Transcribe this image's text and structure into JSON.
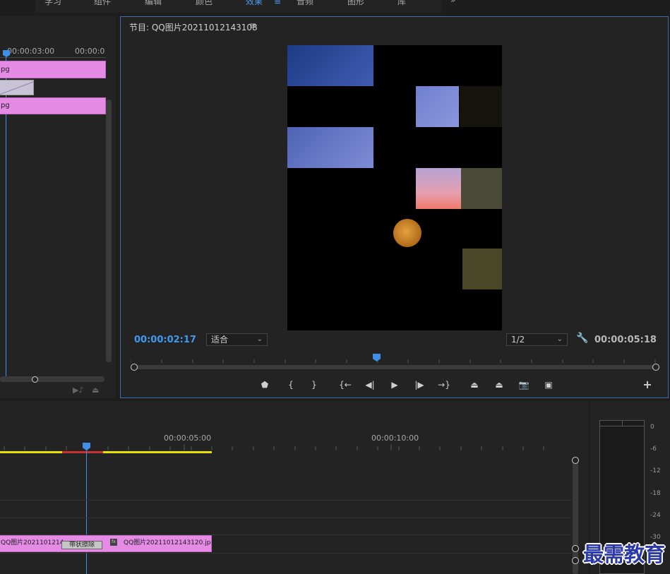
{
  "workspace_tabs": [
    "学习",
    "组件",
    "编辑",
    "颜色",
    "效果",
    "音频",
    "图形",
    "库"
  ],
  "workspace_active": "效果",
  "workspace_overflow": "»",
  "left_panel": {
    "timecodes": [
      "00:00:03:00",
      "00:00:0"
    ],
    "clip_top_label": "pg",
    "clip_bottom_label": "pg"
  },
  "program": {
    "title": "节目: QQ图片20211012143108",
    "menu_icon": "≡",
    "current_time": "00:00:02:17",
    "fit_label": "适合",
    "resolution_label": "1/2",
    "duration": "00:00:05:18",
    "wrench_icon": "wrench-icon",
    "controls": [
      {
        "name": "add-marker-button",
        "glyph": "⬟"
      },
      {
        "name": "mark-in-button",
        "glyph": "{"
      },
      {
        "name": "mark-out-button",
        "glyph": "}"
      },
      {
        "name": "go-to-in-button",
        "glyph": "{←"
      },
      {
        "name": "step-back-button",
        "glyph": "◀|"
      },
      {
        "name": "play-button",
        "glyph": "▶"
      },
      {
        "name": "step-forward-button",
        "glyph": "|▶"
      },
      {
        "name": "go-to-out-button",
        "glyph": "→}"
      },
      {
        "name": "lift-button",
        "glyph": "⏏"
      },
      {
        "name": "extract-button",
        "glyph": "⏏"
      },
      {
        "name": "export-frame-button",
        "glyph": "📷"
      },
      {
        "name": "comparison-view-button",
        "glyph": "▣"
      }
    ],
    "add_button": "+"
  },
  "timeline": {
    "timecodes": [
      "00:00:05:00",
      "00:00:10:00"
    ],
    "clip_left_label": "QQ图片2021101214",
    "transition_label": "带状擦除",
    "fx_badge": "fx",
    "clip_right_label": "QQ图片20211012143120.jpg"
  },
  "meter": {
    "db_labels": [
      "0",
      "-6",
      "-12",
      "-18",
      "-24",
      "-30"
    ]
  },
  "watermark": "最需教育",
  "colors": {
    "accent": "#3f9bf0",
    "clip": "#e58be5",
    "work_area": "#e8e000",
    "render_bar": "#c83232"
  }
}
